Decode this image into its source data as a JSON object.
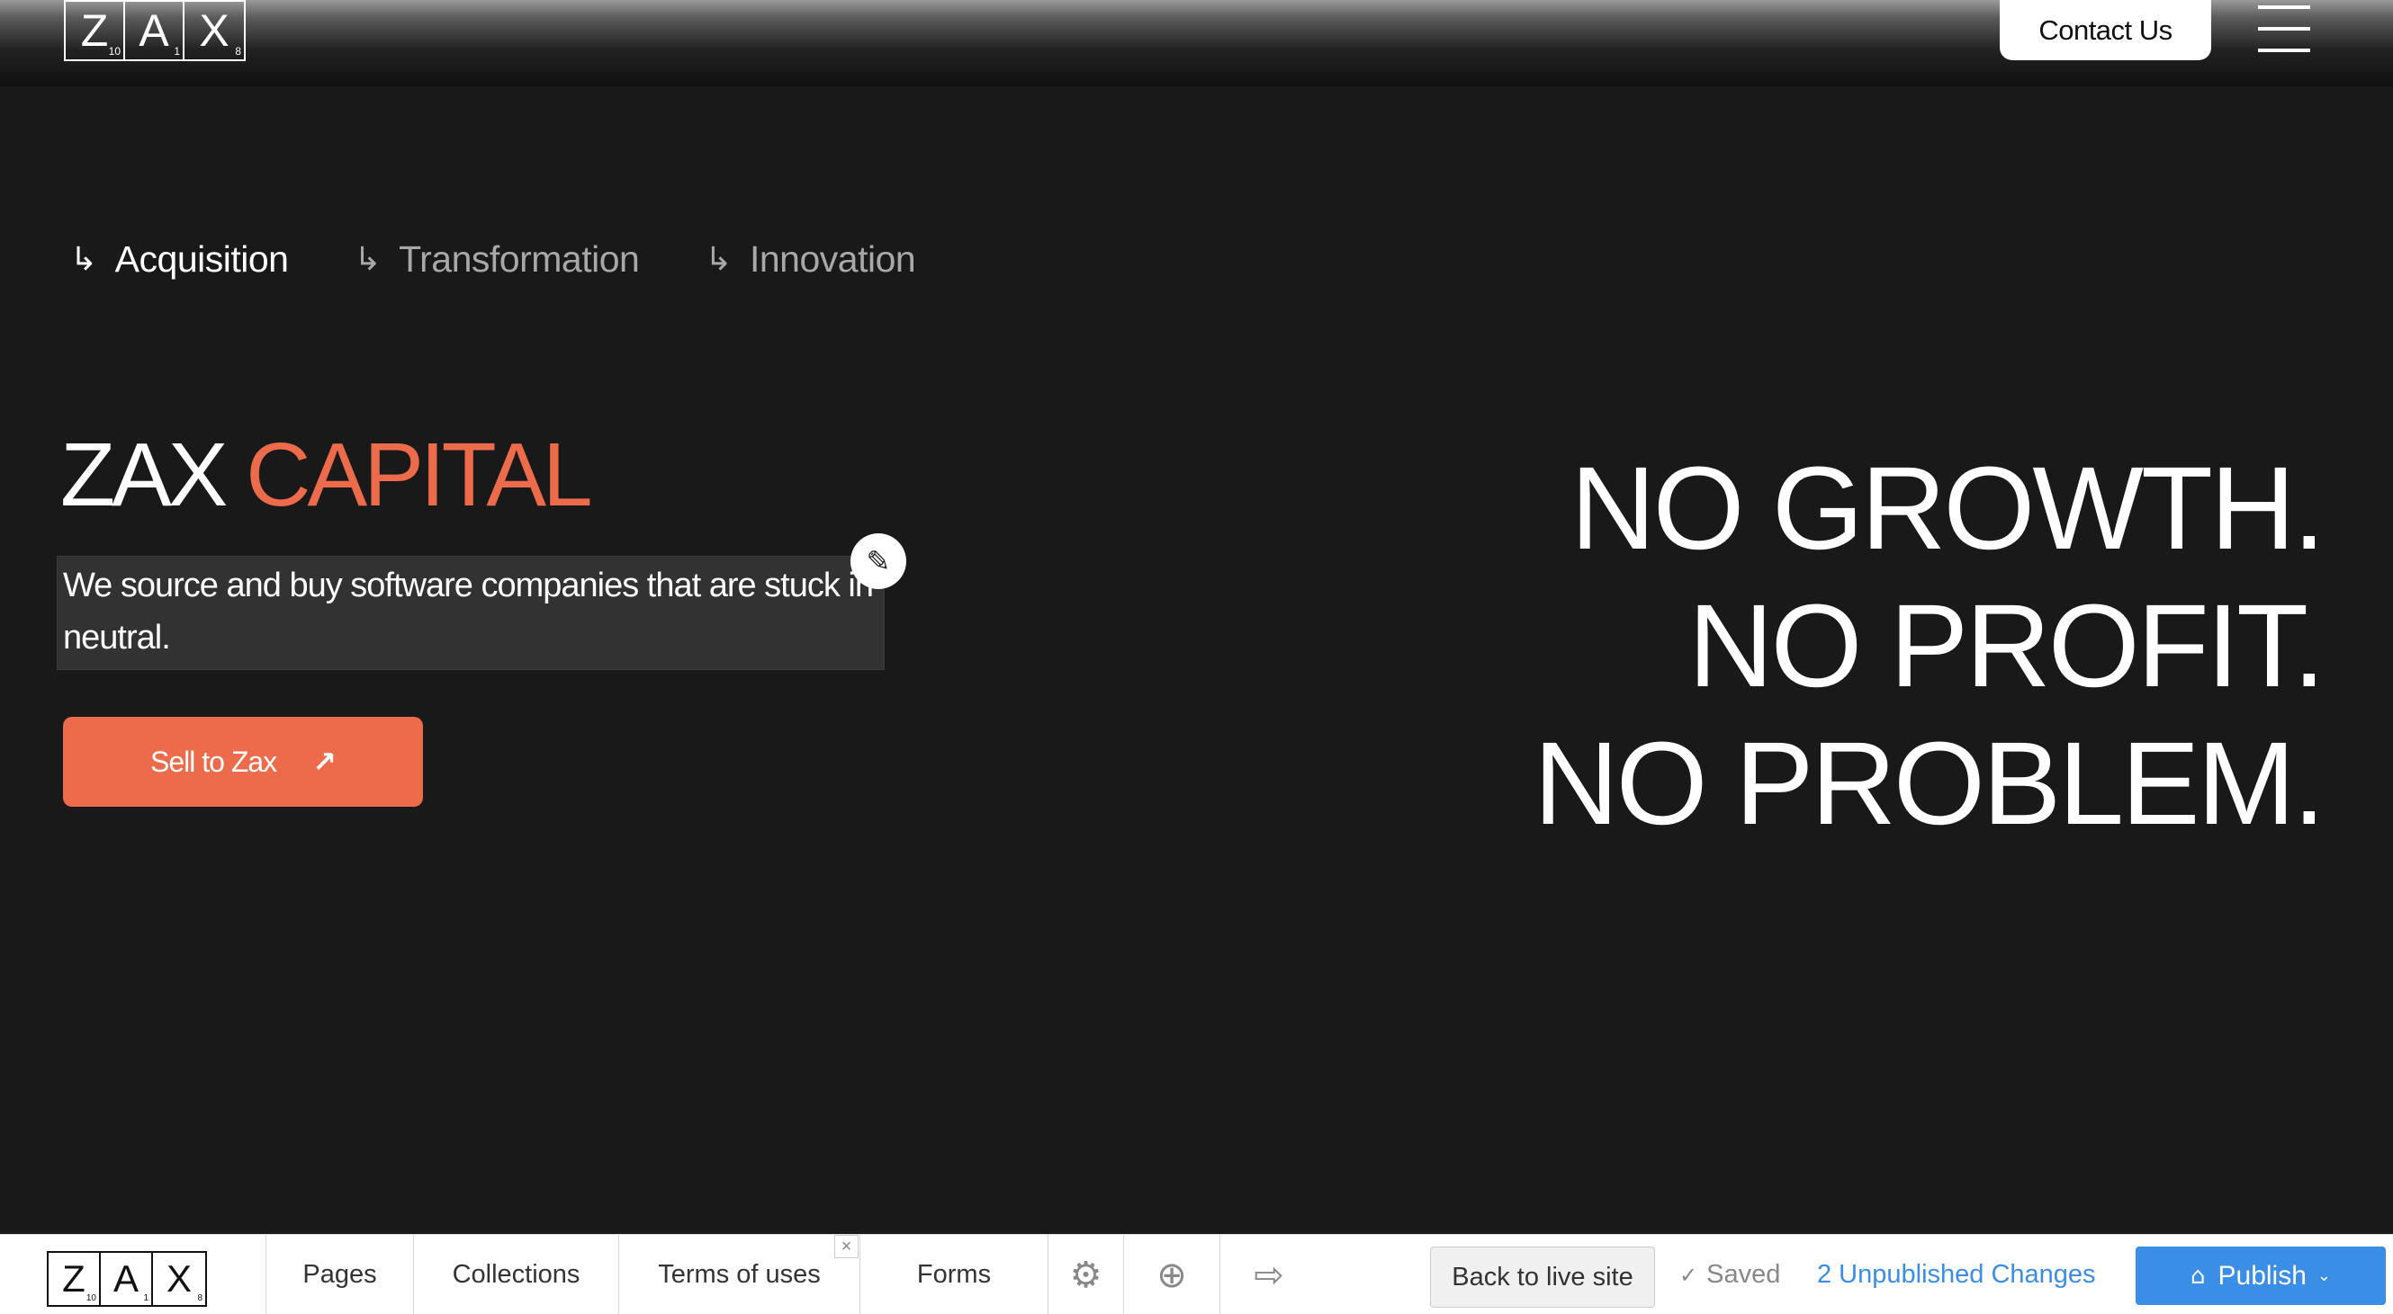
{
  "header": {
    "logo": [
      {
        "letter": "Z",
        "num": "10"
      },
      {
        "letter": "A",
        "num": "1"
      },
      {
        "letter": "X",
        "num": "8"
      }
    ],
    "contact_label": "Contact Us"
  },
  "topics": [
    {
      "arrow": "↳",
      "label": "Acquisition"
    },
    {
      "arrow": "↳",
      "label": "Transformation"
    },
    {
      "arrow": "↳",
      "label": "Innovation"
    }
  ],
  "hero": {
    "brand_main": "ZAX",
    "brand_accent": "CAPITAL",
    "description": "We source and buy software companies that are stuck in neutral.",
    "cta_label": "Sell to Zax",
    "cta_arrow": "↗",
    "slogan": [
      "NO GROWTH.",
      "NO PROFIT.",
      "NO PROBLEM."
    ]
  },
  "editbar": {
    "items": [
      "Pages",
      "Collections",
      "Terms of uses",
      "Forms"
    ],
    "close_glyph": "×",
    "icons": {
      "settings": "⚙",
      "help": "⊕",
      "logout": "⇨"
    },
    "back_label": "Back to live site",
    "saved_label": "Saved",
    "check_glyph": "✓",
    "unpublished_label": "2 Unpublished Changes",
    "publish_label": "Publish",
    "publish_icon": "⌂",
    "chevron": "⌄"
  },
  "colors": {
    "accent": "#ec6b4b",
    "background": "#1a1919",
    "link_blue": "#3a8ee6"
  }
}
